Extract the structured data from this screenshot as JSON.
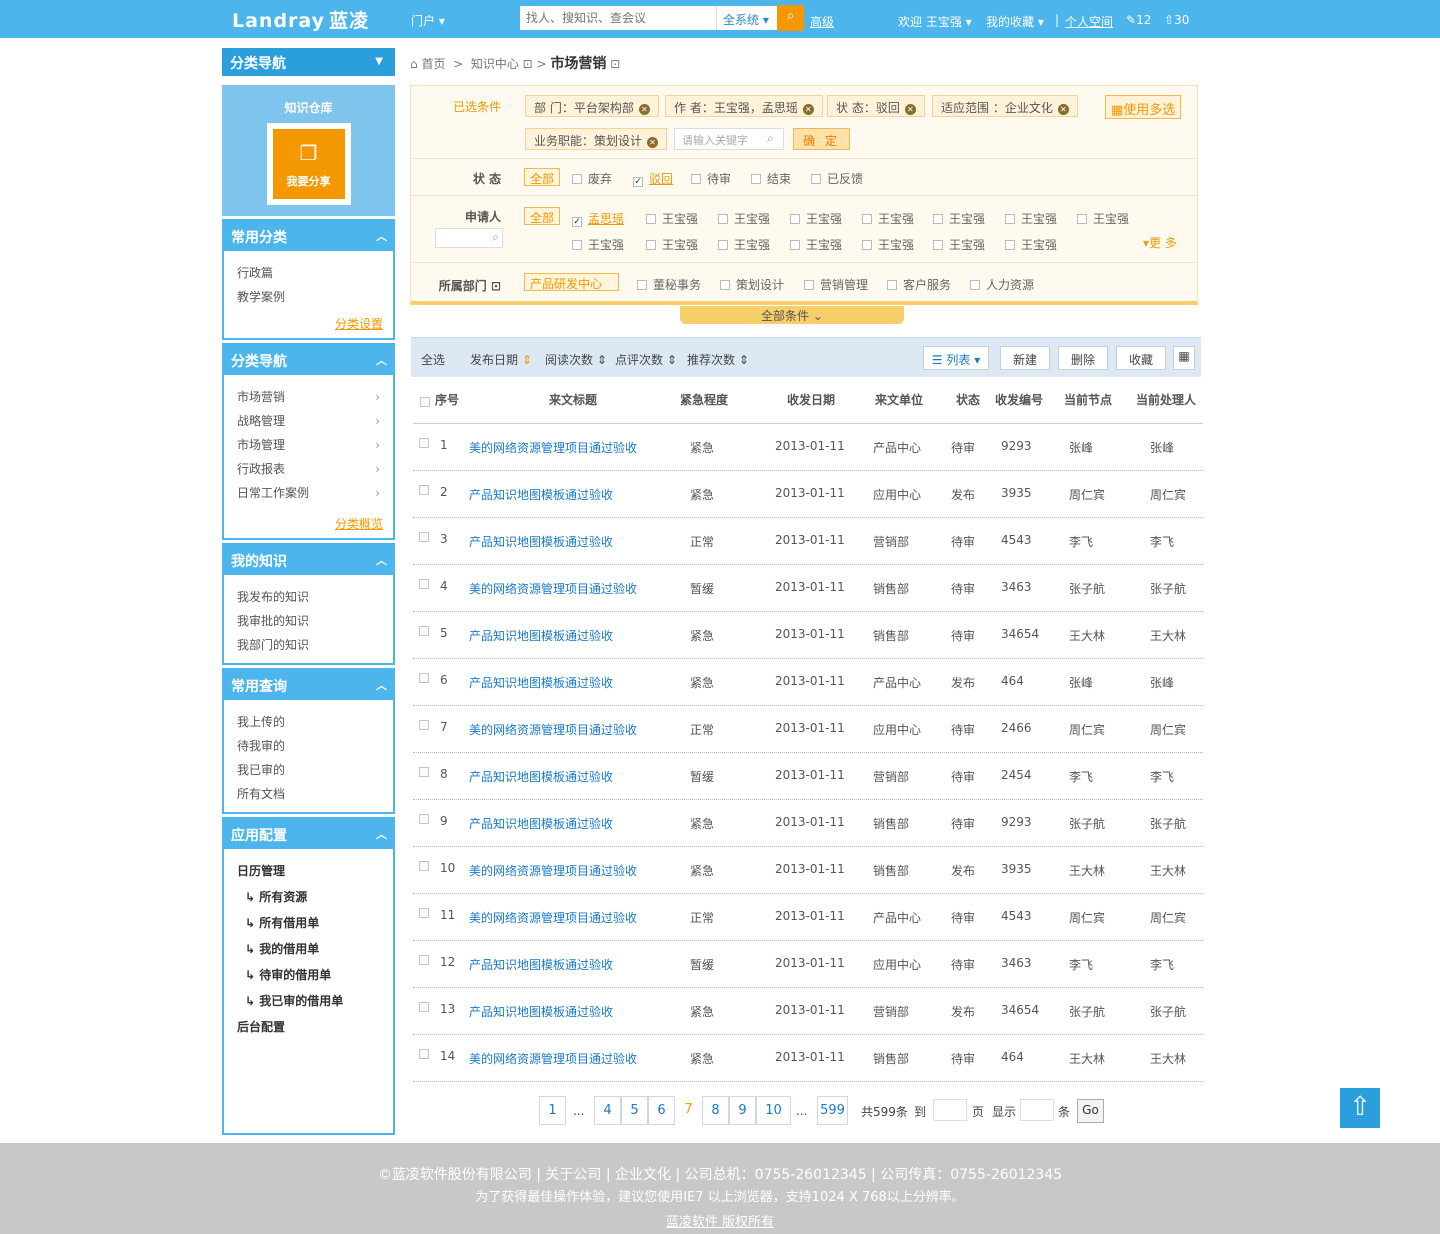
{
  "header": {
    "logo": "Landray",
    "logo_cn": "蓝凌",
    "portal": "门户 ▾",
    "search_placeholder": "找人、搜知识、查会议",
    "scope": "全系统 ▾",
    "advanced": "高级",
    "welcome": "欢迎",
    "user": "王宝强 ▾",
    "favorites": "我的收藏 ▾",
    "personal": "个人空间",
    "sep": "|",
    "edit_count": "12",
    "upload_count": "30"
  },
  "sidebar": {
    "nav_title": "分类导航",
    "kb_title": "知识仓库",
    "share": "我要分享",
    "common_cat": {
      "title": "常用分类",
      "items": [
        "行政篇",
        "教学案例"
      ],
      "more": "分类设置"
    },
    "cat_nav": {
      "title": "分类导航",
      "items": [
        "市场营销",
        "战略管理",
        "市场管理",
        "行政报表",
        "日常工作案例"
      ],
      "more": "分类概览"
    },
    "my_knowledge": {
      "title": "我的知识",
      "items": [
        "我发布的知识",
        "我审批的知识",
        "我部门的知识"
      ]
    },
    "common_query": {
      "title": "常用查询",
      "items": [
        "我上传的",
        "待我审的",
        "我已审的",
        "所有文档"
      ]
    },
    "app_config": {
      "title": "应用配置",
      "cal": "日历管理",
      "items": [
        "所有资源",
        "所有借用单",
        "我的借用单",
        "待审的借用单",
        "我已审的借用单"
      ],
      "backend": "后台配置"
    }
  },
  "breadcrumb": {
    "home": "首页",
    "sep1": ">",
    "center": "知识中心",
    "sep2": ">",
    "current": "市场营销"
  },
  "filter": {
    "selected_label": "已选条件",
    "tags": [
      "部 门：平台架构部",
      "作 者：王宝强，孟思瑶",
      "状 态：驳回",
      "适应范围 ：企业文化",
      "业务职能：策划设计"
    ],
    "keyword_placeholder": "请输入关键字",
    "ok": "确 定",
    "multi": "使用多选",
    "status_label": "状 态",
    "all": "全部",
    "status_options": [
      "废弃",
      "驳回",
      "待审",
      "结束",
      "已反馈"
    ],
    "applicant_label": "申请人",
    "applicant_options": [
      "孟思瑶",
      "王宝强",
      "王宝强",
      "王宝强",
      "王宝强",
      "王宝强",
      "王宝强",
      "王宝强",
      "王宝强",
      "王宝强",
      "王宝强",
      "王宝强",
      "王宝强",
      "王宝强",
      "王宝强"
    ],
    "more": "更 多",
    "dept_label": "所属部门",
    "dept_selected": "产品研发中心",
    "dept_options": [
      "董秘事务",
      "策划设计",
      "营销管理",
      "客户服务",
      "人力资源"
    ],
    "all_conditions": "全部条件"
  },
  "toolbar": {
    "select_all": "全选",
    "sort": [
      "发布日期",
      "阅读次数",
      "点评次数",
      "推荐次数"
    ],
    "view": "列表 ▾",
    "new": "新建",
    "delete": "删除",
    "favorite": "收藏"
  },
  "table": {
    "headers": [
      "序号",
      "来文标题",
      "紧急程度",
      "收发日期",
      "来文单位",
      "状态",
      "收发编号",
      "当前节点",
      "当前处理人"
    ],
    "rows": [
      [
        "1",
        "美的网络资源管理项目通过验收",
        "紧急",
        "2013-01-11",
        "产品中心",
        "待审",
        "9293",
        "张峰",
        "张峰"
      ],
      [
        "2",
        "产品知识地图模板通过验收",
        "紧急",
        "2013-01-11",
        "应用中心",
        "发布",
        "3935",
        "周仁宾",
        "周仁宾"
      ],
      [
        "3",
        "产品知识地图模板通过验收",
        "正常",
        "2013-01-11",
        "营销部",
        "待审",
        "4543",
        "李飞",
        "李飞"
      ],
      [
        "4",
        "美的网络资源管理项目通过验收",
        "暂缓",
        "2013-01-11",
        "销售部",
        "待审",
        "3463",
        "张子航",
        "张子航"
      ],
      [
        "5",
        "产品知识地图模板通过验收",
        "紧急",
        "2013-01-11",
        "销售部",
        "待审",
        "34654",
        "王大林",
        "王大林"
      ],
      [
        "6",
        "产品知识地图模板通过验收",
        "紧急",
        "2013-01-11",
        "产品中心",
        "发布",
        "464",
        "张峰",
        "张峰"
      ],
      [
        "7",
        "美的网络资源管理项目通过验收",
        "正常",
        "2013-01-11",
        "应用中心",
        "待审",
        "2466",
        "周仁宾",
        "周仁宾"
      ],
      [
        "8",
        "产品知识地图模板通过验收",
        "暂缓",
        "2013-01-11",
        "营销部",
        "待审",
        "2454",
        "李飞",
        "李飞"
      ],
      [
        "9",
        "产品知识地图模板通过验收",
        "紧急",
        "2013-01-11",
        "销售部",
        "待审",
        "9293",
        "张子航",
        "张子航"
      ],
      [
        "10",
        "美的网络资源管理项目通过验收",
        "紧急",
        "2013-01-11",
        "销售部",
        "发布",
        "3935",
        "王大林",
        "王大林"
      ],
      [
        "11",
        "美的网络资源管理项目通过验收",
        "正常",
        "2013-01-11",
        "产品中心",
        "待审",
        "4543",
        "周仁宾",
        "周仁宾"
      ],
      [
        "12",
        "产品知识地图模板通过验收",
        "暂缓",
        "2013-01-11",
        "应用中心",
        "待审",
        "3463",
        "李飞",
        "李飞"
      ],
      [
        "13",
        "产品知识地图模板通过验收",
        "紧急",
        "2013-01-11",
        "营销部",
        "发布",
        "34654",
        "张子航",
        "张子航"
      ],
      [
        "14",
        "美的网络资源管理项目通过验收",
        "紧急",
        "2013-01-11",
        "销售部",
        "待审",
        "464",
        "王大林",
        "王大林"
      ]
    ]
  },
  "pager": {
    "pages": [
      "1",
      "...",
      "4",
      "5",
      "6",
      "7",
      "8",
      "9",
      "10",
      "...",
      "599"
    ],
    "current": "7",
    "total": "共599条",
    "goto": "到",
    "page_unit": "页",
    "show": "显示",
    "item_unit": "条",
    "go": "Go"
  },
  "footer": {
    "line1": "©蓝凌软件股份有限公司 | 关于公司 | 企业文化  |  公司总机：0755-26012345 | 公司传真：0755-26012345",
    "line2": "为了获得最佳操作体验，建议您使用IE7 以上浏览器，支持1024 X 768以上分辨率。",
    "line3": "蓝凌软件 版权所有"
  },
  "colors": {
    "brand_blue": "#4cb5ec",
    "accent_orange": "#f39800",
    "link_blue": "#1a7ac7"
  }
}
